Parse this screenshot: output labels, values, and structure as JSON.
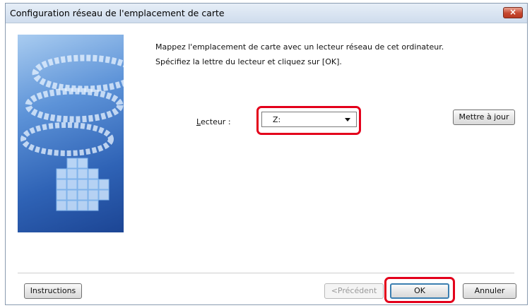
{
  "window": {
    "title": "Configuration réseau de l'emplacement de carte",
    "close_label": "×"
  },
  "message": {
    "line1": "Mappez l'emplacement de carte avec un lecteur réseau de cet ordinateur.",
    "line2": "Spécifiez la lettre du lecteur et cliquez sur [OK]."
  },
  "drive": {
    "label_accesskey": "L",
    "label_rest": "ecteur :",
    "selected": "Z:"
  },
  "buttons": {
    "update": "Mettre à jour",
    "instructions": "Instructions",
    "previous": "<Précédent",
    "ok": "OK",
    "cancel": "Annuler"
  },
  "colors": {
    "highlight": "#e3001b",
    "titlebar": "#cfdced",
    "close": "#c6472e"
  }
}
